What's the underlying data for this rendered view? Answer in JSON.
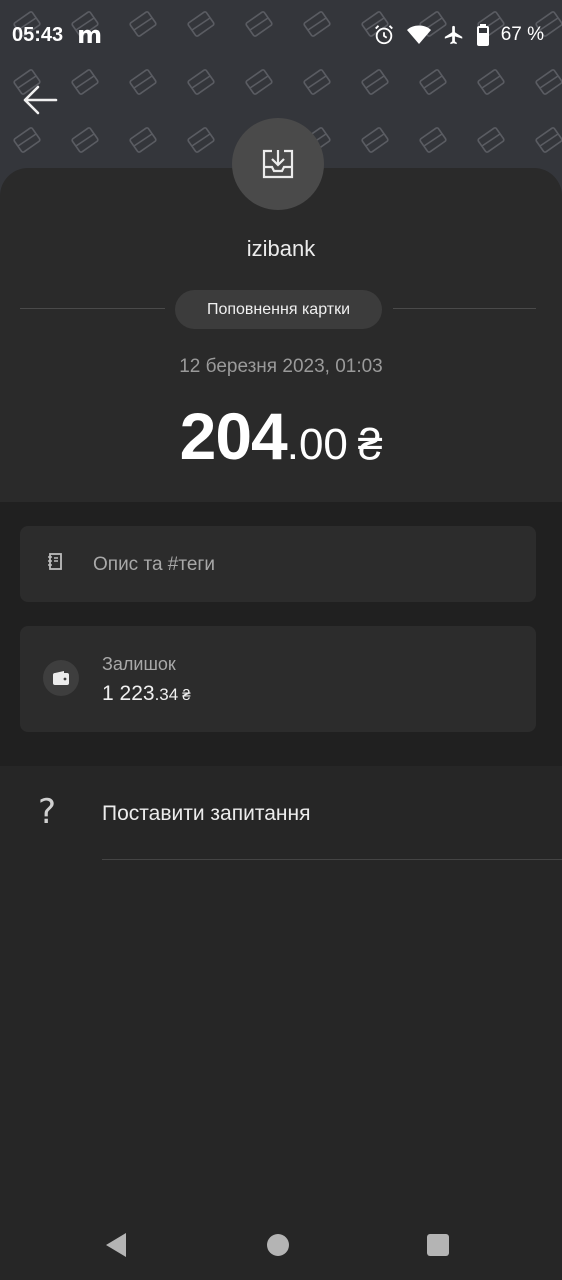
{
  "status_bar": {
    "time": "05:43",
    "app_glyph": "m",
    "battery": "67 %",
    "icons": [
      "alarm-icon",
      "wifi-icon",
      "airplane-icon",
      "battery-icon"
    ]
  },
  "header": {
    "back_icon": "arrow-left-icon",
    "transaction_icon": "download-tray-icon"
  },
  "transaction": {
    "merchant": "izibank",
    "category": "Поповнення картки",
    "date": "12 березня 2023, 01:03",
    "amount_int": "204",
    "amount_dec": ".00",
    "currency": "₴"
  },
  "description": {
    "icon": "notebook-icon",
    "placeholder": "Опис та #теги"
  },
  "balance": {
    "icon": "wallet-icon",
    "label": "Залишок",
    "value_int": "1 223",
    "value_dec": ".34",
    "currency": "₴"
  },
  "support": {
    "icon": "question-icon",
    "label": "Поставити запитання"
  },
  "colors": {
    "background": "#262626",
    "header_pattern": "#34363b",
    "card": "#2a2a2a",
    "section": "#202020"
  }
}
